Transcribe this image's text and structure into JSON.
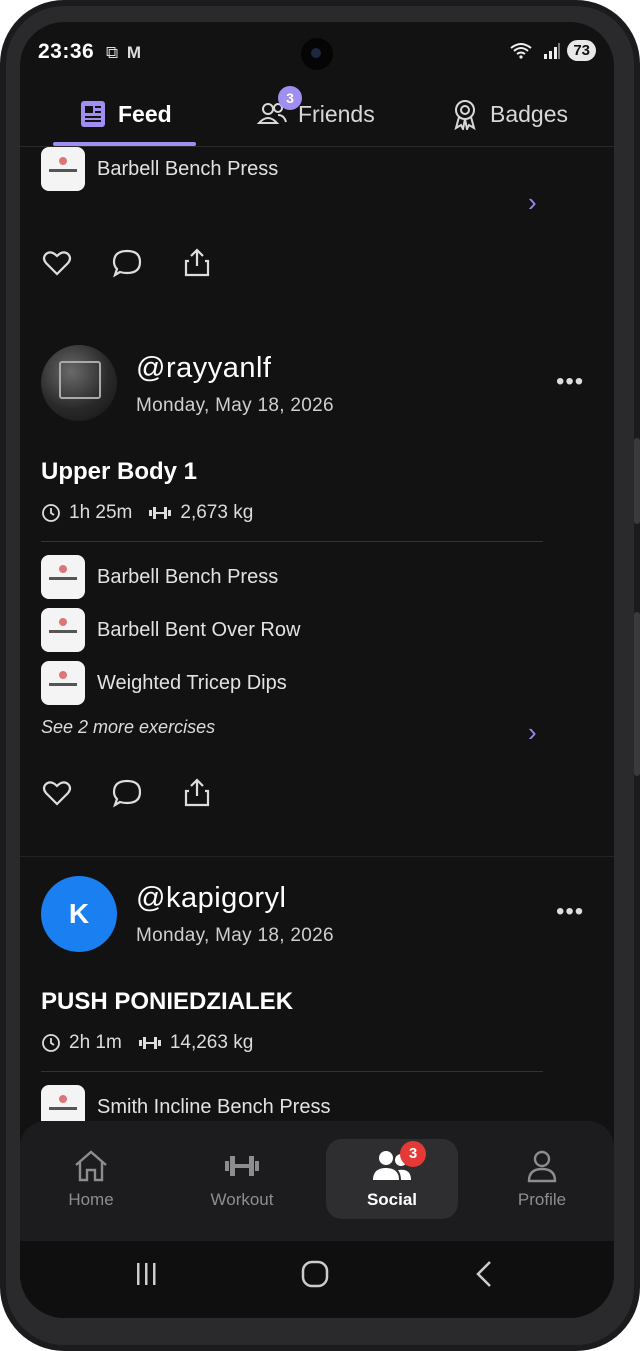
{
  "status_bar": {
    "time": "23:36",
    "battery": "73"
  },
  "tabs": [
    {
      "label": "Feed",
      "icon": "newspaper-icon",
      "active": true
    },
    {
      "label": "Friends",
      "icon": "friends-icon",
      "badge": "3"
    },
    {
      "label": "Badges",
      "icon": "badge-icon"
    }
  ],
  "posts": [
    {
      "exercises": [
        "Barbell Bench Press"
      ]
    },
    {
      "username": "@rayyanlf",
      "date": "Monday, May 18, 2026",
      "title": "Upper Body 1",
      "duration": "1h 25m",
      "volume": "2,673 kg",
      "exercises": [
        "Barbell Bench Press",
        "Barbell Bent Over Row",
        "Weighted Tricep Dips"
      ],
      "see_more": "See 2 more exercises"
    },
    {
      "username": "@kapigoryl",
      "avatar_letter": "K",
      "date": "Monday, May 18, 2026",
      "title": "PUSH PONIEDZIALEK",
      "duration": "2h 1m",
      "volume": "14,263 kg",
      "exercises": [
        "Smith Incline Bench Press"
      ]
    }
  ],
  "bottom_nav": [
    {
      "label": "Home",
      "icon": "home-icon"
    },
    {
      "label": "Workout",
      "icon": "dumbbell-icon"
    },
    {
      "label": "Social",
      "icon": "people-icon",
      "active": true,
      "badge": "3"
    },
    {
      "label": "Profile",
      "icon": "profile-icon"
    }
  ],
  "colors": {
    "accent": "#a08ef0",
    "badge_red": "#e53935",
    "avatar_blue": "#1a7ff0",
    "background": "#121212"
  }
}
